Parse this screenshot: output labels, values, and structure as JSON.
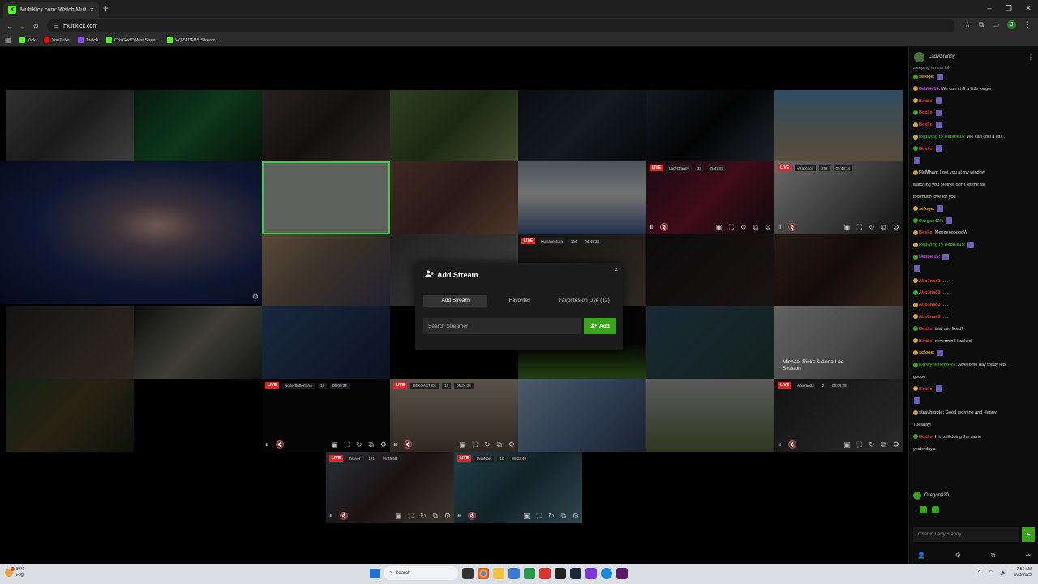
{
  "browser": {
    "tab_title": "MultiKick.com: Watch Multiple",
    "tab_favicon": "K",
    "tab_close": "×",
    "new_tab": "+",
    "url": "multikick.com",
    "profile_initial": "J",
    "window_controls": [
      "–",
      "❐",
      "✕"
    ],
    "bookmarks": [
      {
        "label": "Kick",
        "color": "#53fc18"
      },
      {
        "label": "YouTube",
        "color": "#ff0000"
      },
      {
        "label": "Twitch",
        "color": "#9146ff"
      },
      {
        "label": "CrisGodOfWar Strea...",
        "color": "#53fc18"
      },
      {
        "label": "HQZADFPS Stream...",
        "color": "#53fc18"
      }
    ]
  },
  "tiles": [
    {
      "hud": {
        "live": "LIVE",
        "name": "LadyGranny",
        "viewers": "33",
        "time": "05:47:59"
      }
    },
    {
      "hud": {
        "live": "LIVE",
        "name": "yRaccoon",
        "viewers": "252",
        "time": "05:48:34"
      }
    },
    {
      "hud": {
        "live": "LIVE",
        "name": "Kumaventura",
        "viewers": "164",
        "time": "04:45:38"
      }
    },
    {
      "hud": {
        "live": "LIVE",
        "name": "NotterButterInAA",
        "viewers": "18",
        "time": "00:00:33"
      }
    },
    {
      "hud": {
        "live": "LIVE",
        "name": "DEKOAST801",
        "viewers": "16",
        "time": "05:24:06"
      }
    },
    {
      "hud": {
        "live": "LIVE",
        "name": "Abolraed3",
        "viewers": "2",
        "time": "00:06:28"
      }
    },
    {
      "hud": {
        "live": "LIVE",
        "name": "Incliver",
        "viewers": "121",
        "time": "05:45:58"
      }
    },
    {
      "hud": {
        "live": "LIVE",
        "name": "PishNoet",
        "viewers": "10",
        "time": "00:33:49"
      }
    }
  ],
  "tile_overlay_text": "Michael Ricks & Anna Lee Stratton",
  "modal": {
    "title": "Add Stream",
    "close": "×",
    "tabs": [
      "Add Stream",
      "Favorites",
      "Favorites on Live (12)"
    ],
    "search_placeholder": "Search Streamer",
    "add_label": "Add"
  },
  "chat": {
    "channel": "LadyGranny",
    "more": "⋮",
    "top_fragment": "sleeping on me lol",
    "messages": [
      {
        "user": "sefoge:",
        "color": "#e1a438",
        "text": ""
      },
      {
        "user": "Debbie15:",
        "color": "#c84ff0",
        "text": "We can chill a little longer"
      },
      {
        "user": "Boxlie:",
        "color": "#e24a3b",
        "text": ""
      },
      {
        "user": "Boxlie:",
        "color": "#e24a3b",
        "text": ""
      },
      {
        "user": "Boxlie:",
        "color": "#e24a3b",
        "text": ""
      },
      {
        "user": "Replying to Debbie15:",
        "color": "#3aa21b",
        "text": "We can chill a littl..."
      },
      {
        "user": "Boxlie:",
        "color": "#e24a3b",
        "text": ""
      },
      {
        "user": "",
        "color": "#ddd",
        "text": ""
      },
      {
        "user": "FleMhan:",
        "color": "#bbb",
        "text": "I got you at my window"
      },
      {
        "user": "",
        "color": "#ddd",
        "text": "watching you brother don't let me fall"
      },
      {
        "user": "",
        "color": "#ddd",
        "text": "too much love for you"
      },
      {
        "user": "sefoge:",
        "color": "#e1a438",
        "text": ""
      },
      {
        "user": "Oregon420:",
        "color": "#3aa21b",
        "text": ""
      },
      {
        "user": "Boxlie:",
        "color": "#e24a3b",
        "text": "MeeeeooooooW"
      },
      {
        "user": "Replying to Debbie15:",
        "color": "#3aa21b",
        "text": ""
      },
      {
        "user": "Debbie15:",
        "color": "#c84ff0",
        "text": ""
      },
      {
        "user": "",
        "color": "#ddd",
        "text": ""
      },
      {
        "user": "Abo3nad3:",
        "color": "#e24a3b",
        "text": "......"
      },
      {
        "user": "Abo3nad3:",
        "color": "#e24a3b",
        "text": "......"
      },
      {
        "user": "Abo3nad3:",
        "color": "#e24a3b",
        "text": "......"
      },
      {
        "user": "Abo3nad3:",
        "color": "#e24a3b",
        "text": "......"
      },
      {
        "user": "Boxlie:",
        "color": "#e24a3b",
        "text": "that mic fixed?"
      },
      {
        "user": "Boxlie:",
        "color": "#e24a3b",
        "text": "nevermind I asked"
      },
      {
        "user": "sefoge:",
        "color": "#e1a438",
        "text": ""
      },
      {
        "user": "KerwynPromotes:",
        "color": "#3aa21b",
        "text": "Awesome day today lets"
      },
      {
        "user": "",
        "color": "#ddd",
        "text": "goooo"
      },
      {
        "user": "Boxlie:",
        "color": "#e24a3b",
        "text": ""
      },
      {
        "user": "",
        "color": "#e24a3b",
        "text": ""
      },
      {
        "user": "strayhippie:",
        "color": "#bbb",
        "text": "Good morning and Happy"
      },
      {
        "user": "",
        "color": "#ddd",
        "text": "Tuesday!"
      },
      {
        "user": "Boxlie:",
        "color": "#e24a3b",
        "text": "It is still doing the same"
      },
      {
        "user": "",
        "color": "#ddd",
        "text": "yesterday's"
      }
    ],
    "pinned_user": "Oregon420",
    "input_placeholder": "Chat in LadyGranny",
    "send": "➤"
  },
  "taskbar": {
    "temp": "87°F",
    "condition": "Fog",
    "search_label": "Search",
    "time": "7:50 AM",
    "date": "9/23/2025"
  }
}
